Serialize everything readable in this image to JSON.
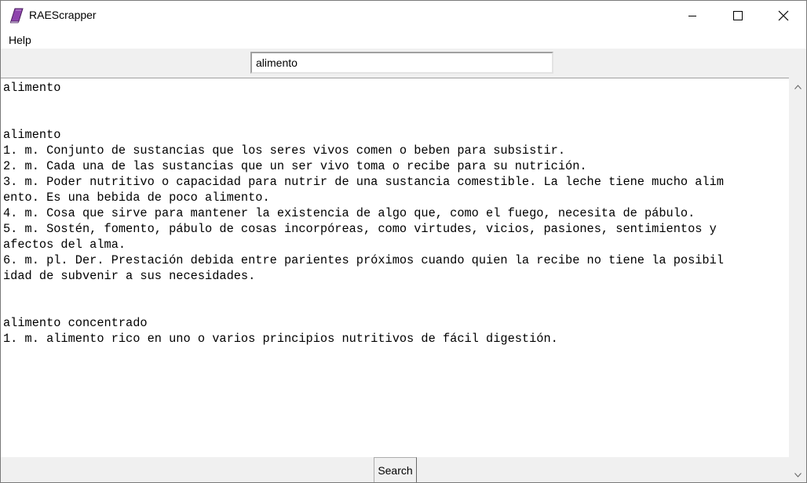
{
  "window": {
    "title": "RAEScrapper",
    "app_icon": "book-icon",
    "controls": [
      "minimize-icon",
      "maximize-icon",
      "close-icon"
    ]
  },
  "menu": {
    "items": [
      {
        "label": "Help"
      }
    ]
  },
  "search": {
    "value": "alimento",
    "button_label": "Search"
  },
  "results": {
    "lines": [
      "alimento",
      "",
      "",
      "alimento",
      "1. m. Conjunto de sustancias que los seres vivos comen o beben para subsistir.",
      "2. m. Cada una de las sustancias que un ser vivo toma o recibe para su nutrición.",
      "3. m. Poder nutritivo o capacidad para nutrir de una sustancia comestible. La leche tiene mucho alim",
      "ento. Es una bebida de poco alimento.",
      "4. m. Cosa que sirve para mantener la existencia de algo que, como el fuego, necesita de pábulo.",
      "5. m. Sostén, fomento, pábulo de cosas incorpóreas, como virtudes, vicios, pasiones, sentimientos y",
      "afectos del alma.",
      "6. m. pl. Der. Prestación debida entre parientes próximos cuando quien la recibe no tiene la posibil",
      "idad de subvenir a sus necesidades.",
      "",
      "",
      "alimento concentrado",
      "1. m. alimento rico en uno o varios principios nutritivos de fácil digestión."
    ]
  },
  "colors": {
    "window_bg": "#f0f0f0",
    "text_bg": "#ffffff",
    "icon_purple": "#8e44ad"
  }
}
